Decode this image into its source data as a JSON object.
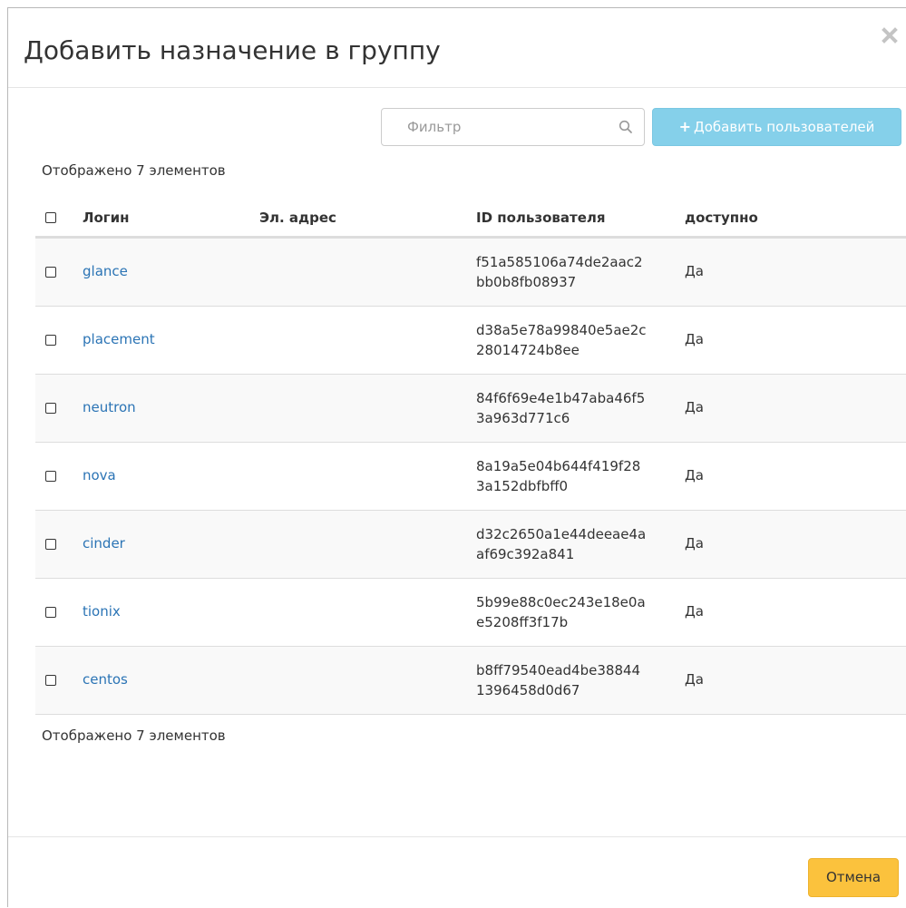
{
  "modal": {
    "title": "Добавить назначение в группу",
    "close_icon": "close-icon"
  },
  "toolbar": {
    "filter_placeholder": "Фильтр",
    "search_icon": "search-icon",
    "add_button_icon": "plus-icon",
    "add_button_label": "Добавить пользователей",
    "add_button_color": "#85d0ea"
  },
  "summary": {
    "top": "Отображено 7 элементов",
    "bottom": "Отображено 7 элементов"
  },
  "table": {
    "columns": [
      "Логин",
      "Эл. адрес",
      "ID пользователя",
      "доступно"
    ],
    "rows": [
      {
        "login": "glance",
        "email": "",
        "id_line1": "f51a585106a74de2aac2",
        "id_line2": "bb0b8fb08937",
        "enabled": "Да"
      },
      {
        "login": "placement",
        "email": "",
        "id_line1": "d38a5e78a99840e5ae2c",
        "id_line2": "28014724b8ee",
        "enabled": "Да"
      },
      {
        "login": "neutron",
        "email": "",
        "id_line1": "84f6f69e4e1b47aba46f5",
        "id_line2": "3a963d771c6",
        "enabled": "Да"
      },
      {
        "login": "nova",
        "email": "",
        "id_line1": "8a19a5e04b644f419f28",
        "id_line2": "3a152dbfbff0",
        "enabled": "Да"
      },
      {
        "login": "cinder",
        "email": "",
        "id_line1": "d32c2650a1e44deeae4a",
        "id_line2": "af69c392a841",
        "enabled": "Да"
      },
      {
        "login": "tionix",
        "email": "",
        "id_line1": "5b99e88c0ec243e18e0a",
        "id_line2": "e5208ff3f17b",
        "enabled": "Да"
      },
      {
        "login": "centos",
        "email": "",
        "id_line1": "b8ff79540ead4be38844",
        "id_line2": "1396458d0d67",
        "enabled": "Да"
      }
    ]
  },
  "footer": {
    "cancel_label": "Отмена",
    "cancel_color": "#fbc23d"
  },
  "colors": {
    "link": "#2b74b5",
    "row_stripe": "#f9f9f9"
  }
}
